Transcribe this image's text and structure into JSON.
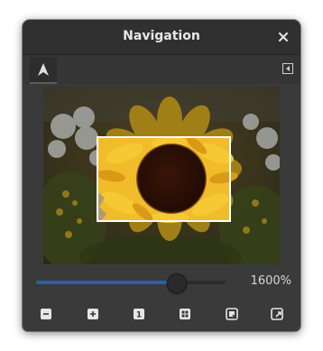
{
  "window": {
    "title": "Navigation"
  },
  "icons": {
    "close": "close-icon",
    "pointer_tool": "pointer-tool-icon",
    "dock_menu": "dock-menu-icon",
    "zoom_out": "zoom-out-icon",
    "zoom_in": "zoom-in-icon",
    "zoom_one_to_one": "zoom-one-to-one-icon",
    "zoom_fit_image": "zoom-fit-image-icon",
    "zoom_fit_selection": "zoom-fit-selection-icon",
    "shrink_wrap": "shrink-wrap-icon"
  },
  "zoom": {
    "label": "1600%",
    "slider_fraction": 0.74
  },
  "bottom_buttons": {
    "zoom_out_glyph": "−",
    "zoom_in_glyph": "+",
    "one_to_one_glyph": "1"
  },
  "colors": {
    "accent": "#2a5fa8",
    "viewport_frame": "#ffffff"
  }
}
